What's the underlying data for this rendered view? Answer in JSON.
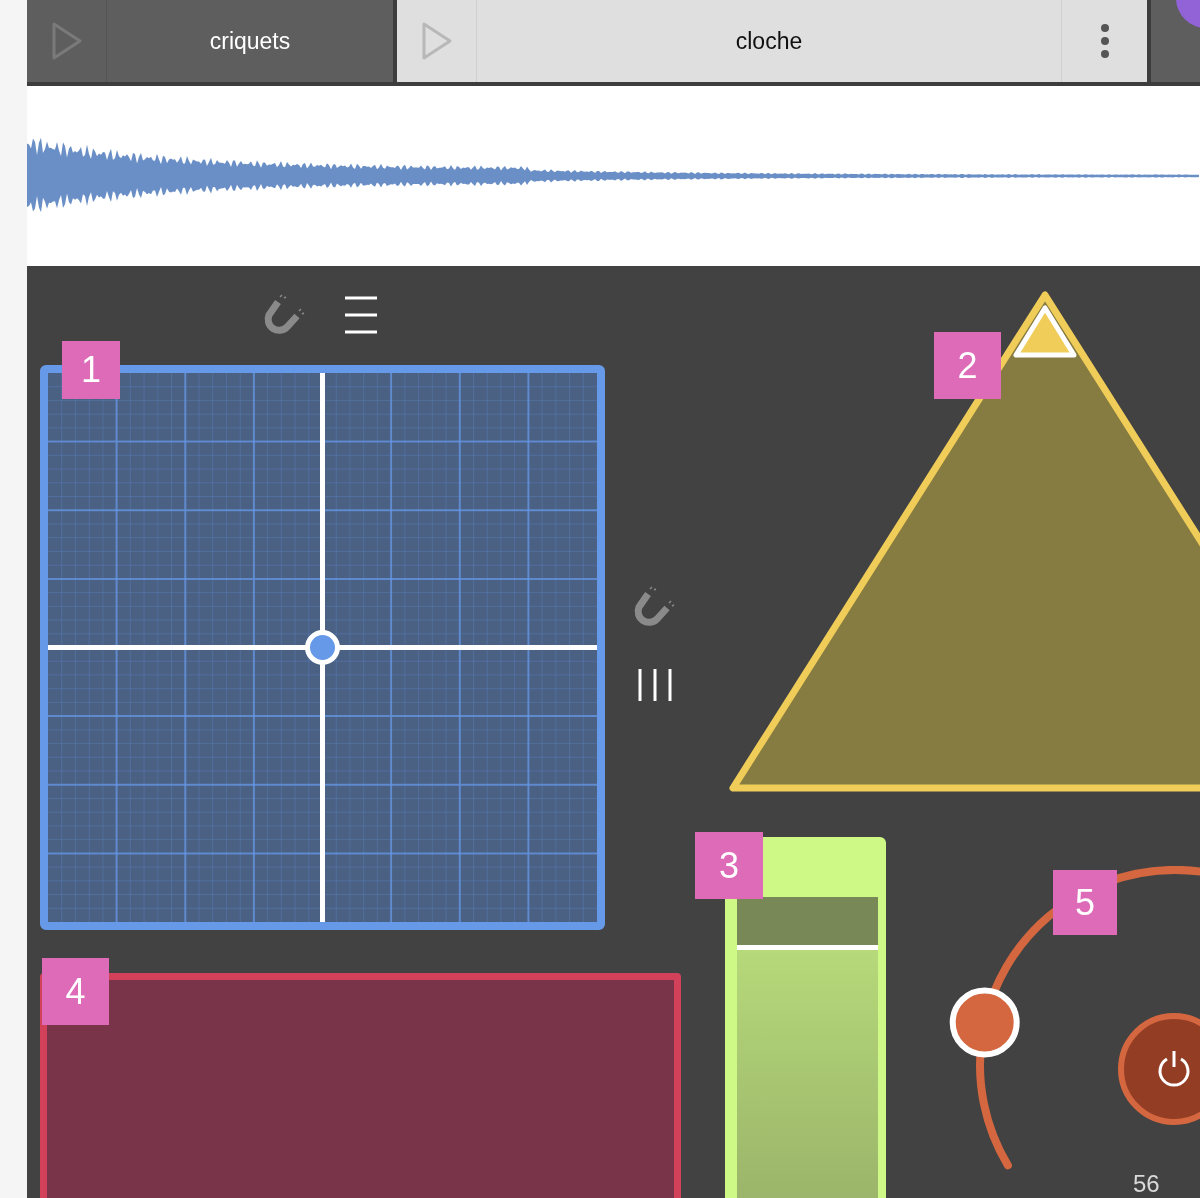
{
  "tabs": [
    {
      "label": "criquets",
      "selected": false
    },
    {
      "label": "cloche",
      "selected": true
    }
  ],
  "pad_tools": [
    {
      "kind": "magnet",
      "on": false
    },
    {
      "kind": "rows"
    }
  ],
  "side_tools": [
    {
      "kind": "magnet",
      "on": false
    },
    {
      "kind": "columns"
    }
  ],
  "widgets": [
    {
      "kind": "xy-pad",
      "badge": "1",
      "axes": [
        {
          "level": 0.5
        },
        {
          "level": 0.5
        }
      ]
    },
    {
      "kind": "triangle",
      "badge": "2"
    },
    {
      "kind": "slider",
      "badge": "3",
      "level": 0.84
    },
    {
      "kind": "pad",
      "badge": "4"
    },
    {
      "kind": "knob",
      "badge": "5",
      "level": 0.18,
      "reading": "56"
    }
  ]
}
